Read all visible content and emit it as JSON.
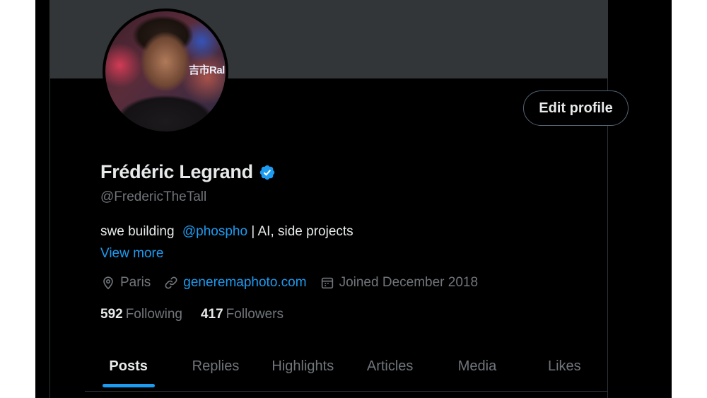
{
  "profile": {
    "display_name": "Frédéric Legrand",
    "handle": "@FredericTheTall",
    "verified": true,
    "avatar_sign_text": "吉市Ral",
    "bio_text": "swe building",
    "bio_mention": "@phospho",
    "bio_rest": "| AI, side projects",
    "view_more": "View more",
    "location": "Paris",
    "website": "generemaphoto.com",
    "joined": "Joined December 2018",
    "following_count": "592",
    "following_label": "Following",
    "followers_count": "417",
    "followers_label": "Followers",
    "edit_profile_label": "Edit profile"
  },
  "icons": {
    "verified": "verified-badge-icon",
    "location": "location-pin-icon",
    "website": "link-icon",
    "joined": "calendar-icon"
  },
  "tabs": [
    {
      "label": "Posts",
      "active": true
    },
    {
      "label": "Replies",
      "active": false
    },
    {
      "label": "Highlights",
      "active": false
    },
    {
      "label": "Articles",
      "active": false
    },
    {
      "label": "Media",
      "active": false
    },
    {
      "label": "Likes",
      "active": false
    }
  ],
  "colors": {
    "background": "#000000",
    "banner": "#333639",
    "accent": "#1d9bf0",
    "primary_text": "#e7e9ea",
    "secondary_text": "#71767b"
  }
}
